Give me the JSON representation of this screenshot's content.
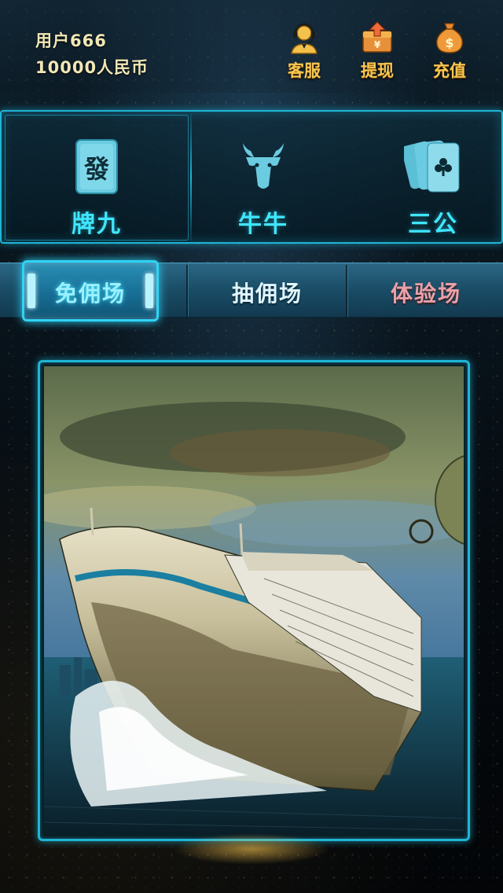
{
  "user": {
    "name": "用户666",
    "balance": "10000人民币"
  },
  "header_buttons": {
    "service": {
      "label": "客服",
      "icon": "headset-agent-icon"
    },
    "withdraw": {
      "label": "提现",
      "icon": "withdraw-yuan-box-icon"
    },
    "recharge": {
      "label": "充值",
      "icon": "money-bag-icon"
    }
  },
  "games": [
    {
      "label": "牌九",
      "icon": "mahjong-fa-tile-icon",
      "tile_char": "發"
    },
    {
      "label": "牛牛",
      "icon": "bull-head-icon"
    },
    {
      "label": "三公",
      "icon": "playing-cards-club-icon"
    }
  ],
  "room_tabs": [
    {
      "label": "免佣场",
      "selected": true
    },
    {
      "label": "抽佣场",
      "selected": false
    },
    {
      "label": "体验场",
      "selected": false
    }
  ],
  "banner": {
    "icon": "cruise-ship-illustration"
  },
  "colors": {
    "accent_cyan": "#1fb5d6",
    "game_label": "#3fe6ff",
    "header_label_gold": "#f7c650",
    "user_text": "#f1e7b6",
    "trial_tab_text": "#e9a0a8"
  }
}
